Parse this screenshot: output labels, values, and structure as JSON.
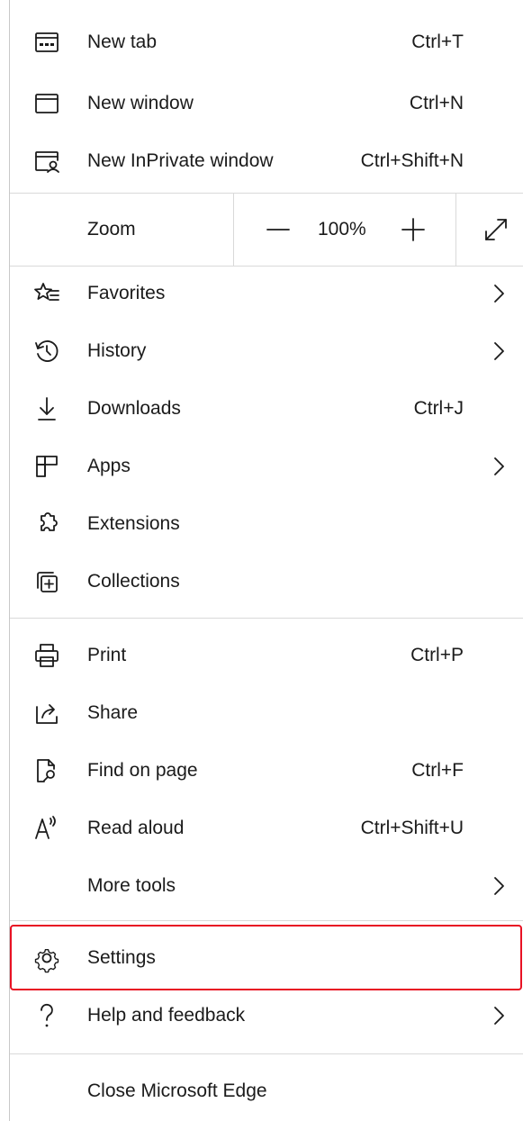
{
  "menu": {
    "new_tab": {
      "label": "New tab",
      "shortcut": "Ctrl+T",
      "icon": "new-tab-icon"
    },
    "new_window": {
      "label": "New window",
      "shortcut": "Ctrl+N",
      "icon": "new-window-icon"
    },
    "new_inprivate": {
      "label": "New InPrivate window",
      "shortcut": "Ctrl+Shift+N",
      "icon": "inprivate-icon"
    },
    "zoom": {
      "label": "Zoom",
      "value": "100%",
      "minus": "—",
      "plus": "+"
    },
    "favorites": {
      "label": "Favorites",
      "icon": "favorites-icon"
    },
    "history": {
      "label": "History",
      "icon": "history-icon"
    },
    "downloads": {
      "label": "Downloads",
      "shortcut": "Ctrl+J",
      "icon": "download-icon"
    },
    "apps": {
      "label": "Apps",
      "icon": "apps-icon"
    },
    "extensions": {
      "label": "Extensions",
      "icon": "extensions-icon"
    },
    "collections": {
      "label": "Collections",
      "icon": "collections-icon"
    },
    "print": {
      "label": "Print",
      "shortcut": "Ctrl+P",
      "icon": "print-icon"
    },
    "share": {
      "label": "Share",
      "icon": "share-icon"
    },
    "find": {
      "label": "Find on page",
      "shortcut": "Ctrl+F",
      "icon": "find-icon"
    },
    "read_aloud": {
      "label": "Read aloud",
      "shortcut": "Ctrl+Shift+U",
      "icon": "read-aloud-icon"
    },
    "more_tools": {
      "label": "More tools"
    },
    "settings": {
      "label": "Settings",
      "icon": "gear-icon"
    },
    "help": {
      "label": "Help and feedback",
      "icon": "question-icon"
    },
    "close": {
      "label": "Close Microsoft Edge"
    }
  },
  "colors": {
    "highlight": "#e81123",
    "divider": "#d9d9d9",
    "text": "#1b1b1b"
  }
}
